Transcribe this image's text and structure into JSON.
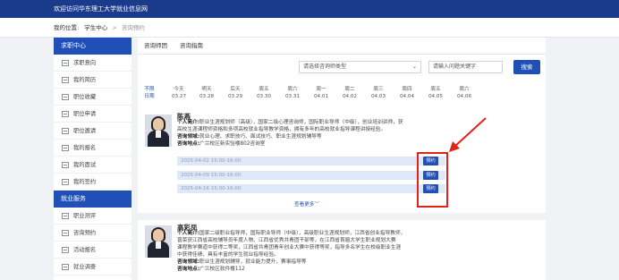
{
  "topbar": {
    "title": "欢迎访问华东理工大学就业信息网"
  },
  "location": {
    "label": "我的位置:",
    "crumb1": "学生中心",
    "sep": ">",
    "crumb2": "咨询预约"
  },
  "sidebar": {
    "section1": "求职中心",
    "items1": [
      "求职意向",
      "我的简历",
      "职位收藏",
      "职位申请",
      "职位邀请",
      "我的报名",
      "我的面试",
      "我的签约"
    ],
    "section2": "就业服务",
    "items2": [
      "职业测评",
      "咨询预约",
      "活动报名",
      "就业调查"
    ]
  },
  "tabs": {
    "tab1": "咨询师团",
    "tab2": "咨询指南"
  },
  "filters": {
    "select_value": "请选择咨询师类型",
    "search_placeholder": "请输入问题关键字",
    "search_button": "搜索"
  },
  "days": [
    {
      "w": "不限",
      "d": "日期"
    },
    {
      "w": "今天",
      "d": "03.27"
    },
    {
      "w": "明天",
      "d": "03.28"
    },
    {
      "w": "后天",
      "d": "03.29"
    },
    {
      "w": "周五",
      "d": "03.30"
    },
    {
      "w": "周六",
      "d": "03.31"
    },
    {
      "w": "周一",
      "d": "04.01"
    },
    {
      "w": "周二",
      "d": "04.02"
    },
    {
      "w": "周三",
      "d": "04.03"
    },
    {
      "w": "周四",
      "d": "04.04"
    },
    {
      "w": "周五",
      "d": "04.05"
    },
    {
      "w": "周六",
      "d": "04.06"
    }
  ],
  "counselor1": {
    "name": "陈燕",
    "intro_label": "个人简介:",
    "intro1": "职业生涯规划师（高级），国家二级心理咨询师，国际职业导师（中级），创业培训讲师，获",
    "intro2": "高校生涯课程师资格和多项高校就业指导教学资格，拥有多年的高校就业指导课程讲授经验。",
    "field_label": "咨询领域:",
    "field": "就业心理、求职技巧、面试技巧、职业生涯规划辅导等",
    "place_label": "咨询地点:",
    "place": "广兰校区新实验楼802咨询室",
    "slots": [
      "2025-04-02  15:00-16:00",
      "2025-04-09  15:00-16:00",
      "2025-04-16  15:00-16:00"
    ],
    "book_label": "预约",
    "more": "查看更多"
  },
  "counselor2": {
    "name": "高彩凤",
    "intro_label": "个人简介:",
    "intro1": "国家二级职业指导师，国际职业导师（中级），高级职业生涯规划师，江西省创业指导教师，",
    "intro2": "曾荣获江西省高校辅导员年度人物、江西省优秀共青团干部等，在江西省首届大学生职业规划大赛",
    "intro3": "课程教学赛道中获得二等奖，江西省共青团青年创业大赛中获得等奖，指导多名学生在校级职业生涯",
    "intro4": "中获得佳绩，具有丰富的学生就业指导经验。",
    "field_label": "咨询领域:",
    "field": "职业生涯规划辅导，就业能力提升，赛事指导等",
    "place_label": "咨询地点:",
    "place": "广兰校区软件楼112"
  },
  "colors": {
    "brand": "#1f4fb7",
    "topbar": "#1a3b8c",
    "highlight": "#e2231a"
  }
}
